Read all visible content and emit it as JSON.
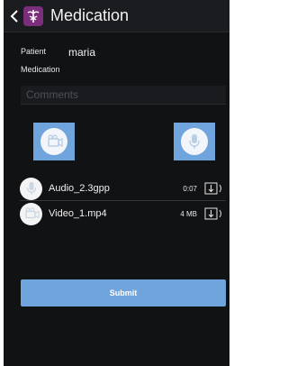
{
  "header": {
    "title": "Medication",
    "back_icon": "chevron-left-icon",
    "app_icon": "caduceus-icon"
  },
  "form": {
    "patient_label": "Patient",
    "patient_value": "maria",
    "medication_label": "Medication",
    "comments_placeholder": "Comments"
  },
  "actions": {
    "video_icon": "video-camera-icon",
    "audio_icon": "microphone-icon"
  },
  "attachments": [
    {
      "name": "Audio_2.3gpp",
      "meta": "0:07",
      "icon": "microphone-icon",
      "action_icon": "download-icon"
    },
    {
      "name": "Video_1.mp4",
      "meta": "4 MB",
      "icon": "video-camera-icon",
      "action_icon": "download-icon"
    }
  ],
  "submit_label": "Submit",
  "colors": {
    "accent": "#6fa4dc",
    "background": "#111214",
    "brand": "#7a2e7c"
  }
}
